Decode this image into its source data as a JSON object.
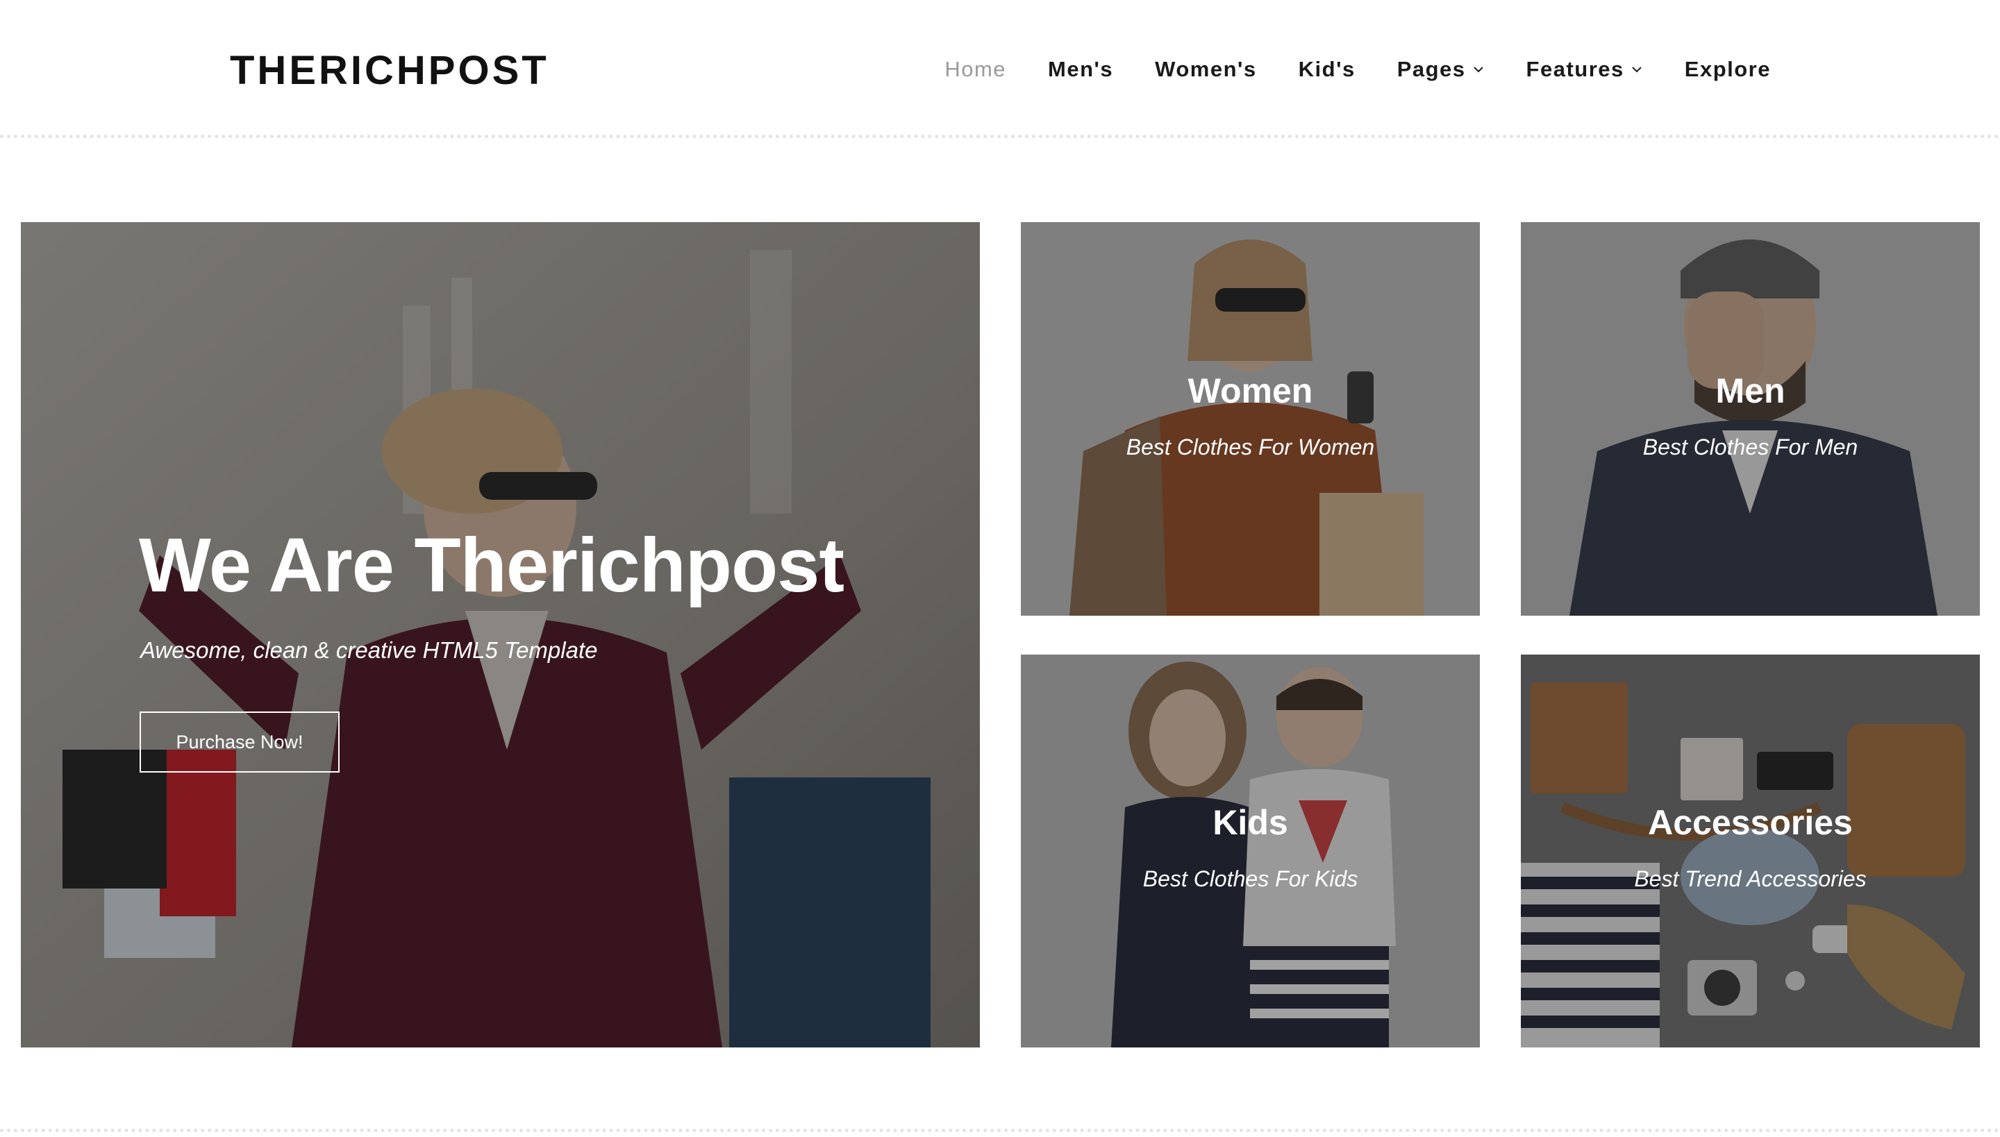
{
  "brand": {
    "logo": "THERICHPOST"
  },
  "nav": {
    "items": [
      {
        "label": "Home",
        "active": true
      },
      {
        "label": "Men's"
      },
      {
        "label": "Women's"
      },
      {
        "label": "Kid's"
      },
      {
        "label": "Pages",
        "dropdown": true
      },
      {
        "label": "Features",
        "dropdown": true
      },
      {
        "label": "Explore"
      }
    ]
  },
  "hero": {
    "title": "We Are Therichpost",
    "subtitle": "Awesome, clean & creative HTML5 Template",
    "button": "Purchase Now!"
  },
  "categories": [
    {
      "title": "Women",
      "subtitle": "Best Clothes For Women"
    },
    {
      "title": "Men",
      "subtitle": "Best Clothes For Men"
    },
    {
      "title": "Kids",
      "subtitle": "Best Clothes For Kids"
    },
    {
      "title": "Accessories",
      "subtitle": "Best Trend Accessories"
    }
  ],
  "colors": {
    "nav_active": "#9a9a9a",
    "text": "#1a1a1a",
    "overlay": "rgba(30,30,30,0.42)"
  },
  "icons": [
    "chevron-down-icon"
  ]
}
